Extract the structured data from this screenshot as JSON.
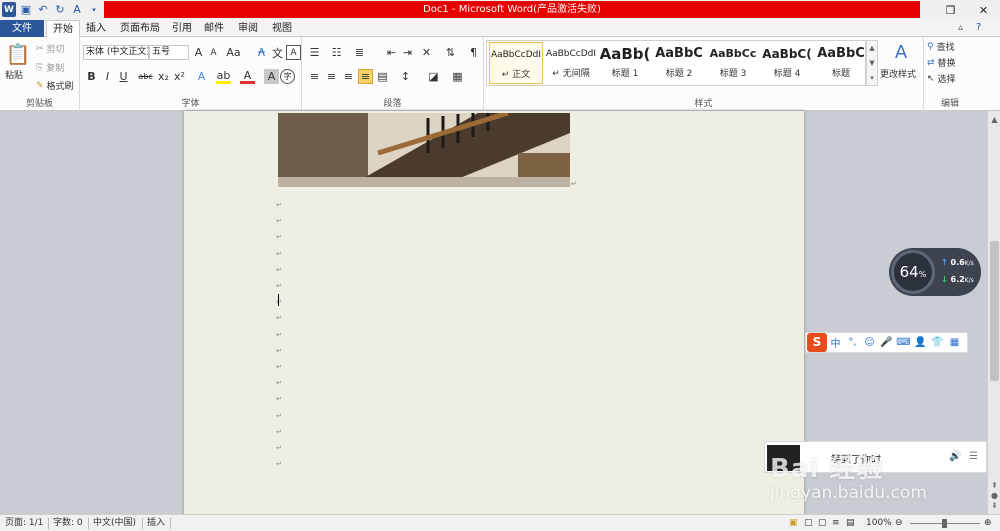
{
  "window": {
    "title": "Doc1 - Microsoft Word(产品激活失败)",
    "qat_icons": [
      "word-icon",
      "save-icon",
      "undo-icon",
      "redo-icon",
      "spelling-icon",
      "customize-qat-icon"
    ]
  },
  "tabs": [
    {
      "label": "文件"
    },
    {
      "label": "开始"
    },
    {
      "label": "插入"
    },
    {
      "label": "页面布局"
    },
    {
      "label": "引用"
    },
    {
      "label": "邮件"
    },
    {
      "label": "审阅"
    },
    {
      "label": "视图"
    }
  ],
  "ribbon": {
    "clipboard": {
      "paste": "粘贴",
      "cut": "剪切",
      "copy": "复制",
      "format_painter": "格式刷",
      "label": "剪贴板"
    },
    "font": {
      "font_name": "宋体 (中文正文)",
      "font_size": "五号",
      "label": "字体"
    },
    "paragraph": {
      "label": "段落"
    },
    "styles": {
      "label": "样式",
      "items": [
        {
          "preview": "AaBbCcDdI",
          "name": "↵ 正文"
        },
        {
          "preview": "AaBbCcDdI",
          "name": "↵ 无间隔"
        },
        {
          "preview": "AaBb(",
          "name": "标题 1"
        },
        {
          "preview": "AaBbC",
          "name": "标题 2"
        },
        {
          "preview": "AaBbCc",
          "name": "标题 3"
        },
        {
          "preview": "AaBbC(",
          "name": "标题 4"
        },
        {
          "preview": "AaBbC",
          "name": "标题"
        }
      ],
      "change_styles": "更改样式"
    },
    "editing": {
      "find": "查找",
      "replace": "替换",
      "select": "选择",
      "label": "编辑"
    }
  },
  "document": {
    "paragraph_mark": "↵",
    "mark_count": 17
  },
  "status": {
    "page": "页面: 1/1",
    "words": "字数: 0",
    "language": "中文(中国)",
    "mode": "插入",
    "zoom": "100%"
  },
  "speed_widget": {
    "percent": "64",
    "percent_unit": "%",
    "up": "0.6",
    "up_unit": "K/s",
    "down": "6.2",
    "down_unit": "K/s"
  },
  "ime": {
    "mode": "中"
  },
  "player": {
    "text": "等到了你时"
  },
  "watermark": {
    "line1": "Bai 经验",
    "line2": "jingyan.baidu.com"
  }
}
